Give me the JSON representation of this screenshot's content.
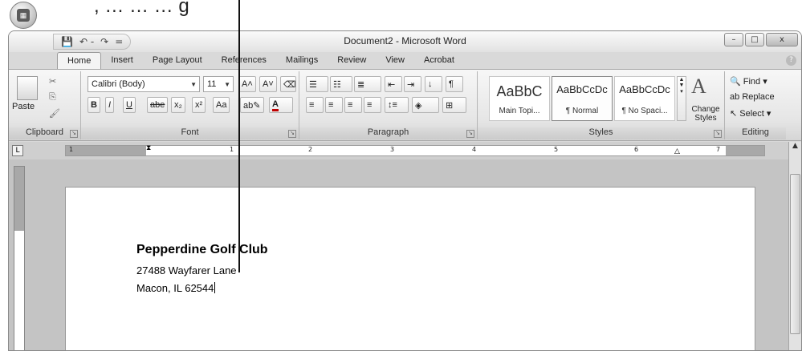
{
  "callout_text": ", … … … g",
  "window": {
    "title": "Document2 - Microsoft Word",
    "controls": [
      "–",
      "□",
      "x"
    ]
  },
  "qat": {
    "save": "💾",
    "undo": "↶ -",
    "redo": "↷",
    "more": "="
  },
  "tabs": [
    "Home",
    "Insert",
    "Page Layout",
    "References",
    "Mailings",
    "Review",
    "View",
    "Acrobat"
  ],
  "help": "?",
  "ribbon": {
    "clipboard": {
      "paste": "Paste",
      "label": "Clipboard"
    },
    "font": {
      "face": "Calibri (Body)",
      "size": "11",
      "grow": "A˄",
      "shrink": "A˅",
      "bold": "B",
      "italic": "I",
      "underline": "U",
      "strike": "abe",
      "sub": "x₂",
      "sup": "x²",
      "case": "Aa",
      "label": "Font"
    },
    "paragraph": {
      "label": "Paragraph",
      "pilcrow": "¶"
    },
    "styles": {
      "items": [
        {
          "preview": "AaBbC",
          "name": "Main Topi..."
        },
        {
          "preview": "AaBbCcDc",
          "name": "¶ Normal"
        },
        {
          "preview": "AaBbCcDc",
          "name": "¶ No Spaci..."
        }
      ],
      "change": "Change Styles",
      "label": "Styles"
    },
    "editing": {
      "find": "Find",
      "replace": "Replace",
      "select": "Select",
      "label": "Editing"
    }
  },
  "ruler_numbers": [
    "1",
    "1",
    "2",
    "3",
    "4",
    "5",
    "6",
    "7"
  ],
  "document": {
    "line1": "Pepperdine Golf Club",
    "line2": "27488  Wayfarer Lane",
    "line3": "Macon, IL 62544"
  }
}
